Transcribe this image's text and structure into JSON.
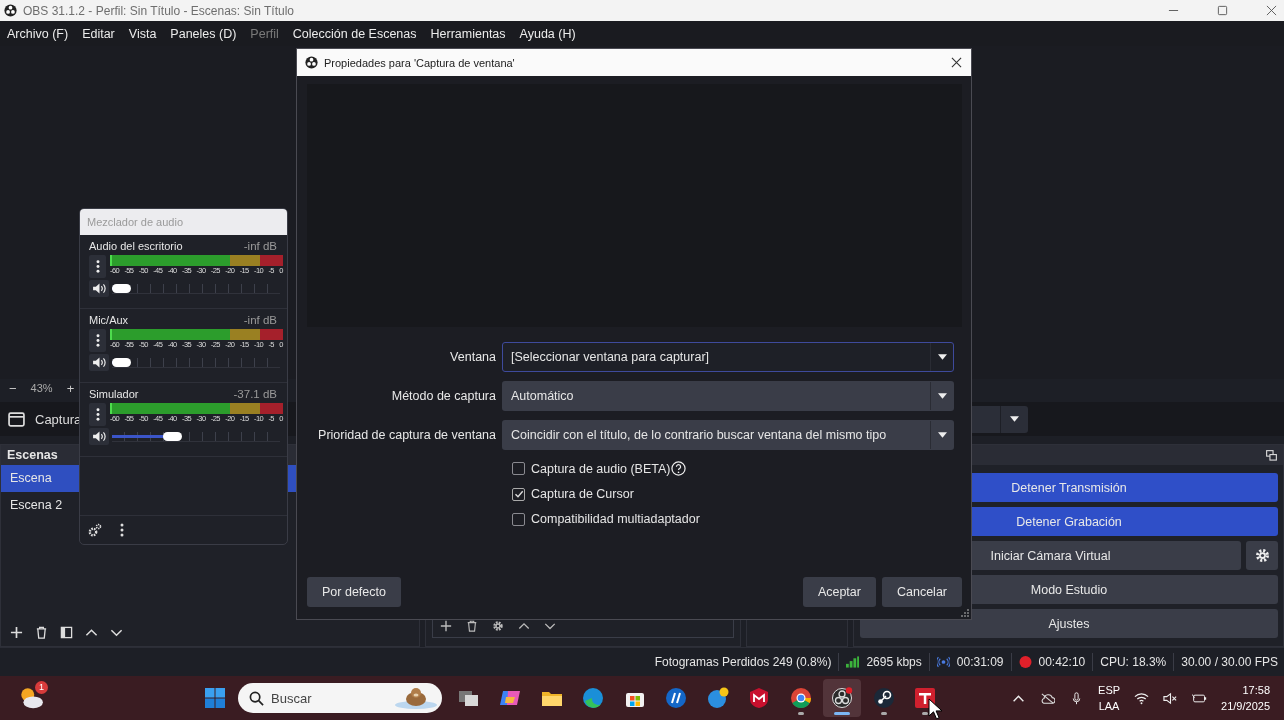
{
  "window": {
    "title": "OBS 31.1.2 - Perfil: Sin Título - Escenas: Sin Título"
  },
  "menu": [
    {
      "label": "Archivo (F)",
      "disabled": false
    },
    {
      "label": "Editar",
      "disabled": false
    },
    {
      "label": "Vista",
      "disabled": false
    },
    {
      "label": "Paneles (D)",
      "disabled": false
    },
    {
      "label": "Perfil",
      "disabled": true
    },
    {
      "label": "Colección de Escenas",
      "disabled": false
    },
    {
      "label": "Herramientas",
      "disabled": false
    },
    {
      "label": "Ayuda (H)",
      "disabled": false
    }
  ],
  "preview": {
    "zoom_out": "−",
    "zoom": "43%",
    "zoom_in": "+"
  },
  "source_toolbar": {
    "source": "Captura"
  },
  "scenes": {
    "title": "Escenas",
    "items": [
      {
        "label": "Escena",
        "selected": true
      },
      {
        "label": "Escena 2",
        "selected": false
      }
    ]
  },
  "controls": {
    "buttons": [
      {
        "label": "Detener Transmisión",
        "active": true,
        "settings": false
      },
      {
        "label": "Detener Grabación",
        "active": true,
        "settings": false
      },
      {
        "label": "Iniciar Cámara Virtual",
        "active": false,
        "settings": true
      },
      {
        "label": "Modo Estudio",
        "active": false,
        "settings": false
      },
      {
        "label": "Ajustes",
        "active": false,
        "settings": false
      }
    ]
  },
  "mixer": {
    "title": "Mezclador de audio",
    "channels": [
      {
        "name": "Audio del escritorio",
        "reading": "-inf dB",
        "level": 0,
        "scale": [
          "-60",
          "-55",
          "-50",
          "-45",
          "-40",
          "-35",
          "-30",
          "-25",
          "-20",
          "-15",
          "-10",
          "-5",
          "0"
        ]
      },
      {
        "name": "Mic/Aux",
        "reading": "-inf dB",
        "level": 0,
        "scale": [
          "-60",
          "-55",
          "-50",
          "-45",
          "-40",
          "-35",
          "-30",
          "-25",
          "-20",
          "-15",
          "-10",
          "-5",
          "0"
        ]
      },
      {
        "name": "Simulador",
        "reading": "-37.1 dB",
        "level": 0.34,
        "scale": [
          "-60",
          "-55",
          "-50",
          "-45",
          "-40",
          "-35",
          "-30",
          "-25",
          "-20",
          "-15",
          "-10",
          "-5",
          "0"
        ]
      }
    ]
  },
  "dialog": {
    "title": "Propiedades para 'Captura de ventana'",
    "fields": [
      {
        "label": "Ventana",
        "value": "[Seleccionar ventana para capturar]",
        "focused": true
      },
      {
        "label": "Método de captura",
        "value": "Automático",
        "focused": false
      },
      {
        "label": "Prioridad de captura de ventana",
        "value": "Coincidir con el título, de lo contrario buscar ventana del mismo tipo",
        "focused": false
      }
    ],
    "checkboxes": [
      {
        "label": "Captura de audio (BETA)",
        "checked": false,
        "help": true
      },
      {
        "label": "Captura de Cursor",
        "checked": true,
        "help": false
      },
      {
        "label": "Compatibilidad multiadaptador",
        "checked": false,
        "help": false
      }
    ],
    "defaults_button": "Por defecto",
    "ok_button": "Aceptar",
    "cancel_button": "Cancelar"
  },
  "status_bar": {
    "dropped_frames": "Fotogramas Perdidos 249 (0.8%)",
    "bitrate": "2695 kbps",
    "stream_time": "00:31:09",
    "record_time": "00:42:10",
    "cpu": "CPU: 18.3%",
    "fps": "30.00 / 30.00 FPS"
  },
  "taskbar": {
    "weather_badge": "1",
    "search": {
      "placeholder": "Buscar"
    },
    "apps": [
      {
        "kind": "taskview",
        "running": false,
        "active": false
      },
      {
        "kind": "copilot",
        "running": false,
        "active": false
      },
      {
        "kind": "explorer",
        "running": false,
        "active": false
      },
      {
        "kind": "edge",
        "running": false,
        "active": false
      },
      {
        "kind": "store",
        "running": false,
        "active": false
      },
      {
        "kind": "hp",
        "running": false,
        "active": false
      },
      {
        "kind": "help",
        "running": false,
        "active": false
      },
      {
        "kind": "mcafee",
        "running": false,
        "active": false
      },
      {
        "kind": "chrome",
        "running": true,
        "active": false
      },
      {
        "kind": "obs",
        "running": true,
        "active": true
      },
      {
        "kind": "steam",
        "running": true,
        "active": false
      },
      {
        "kind": "tile",
        "running": true,
        "active": false
      }
    ],
    "language": "ESP",
    "layout": "LAA",
    "time": "17:58",
    "date": "21/9/2025"
  }
}
